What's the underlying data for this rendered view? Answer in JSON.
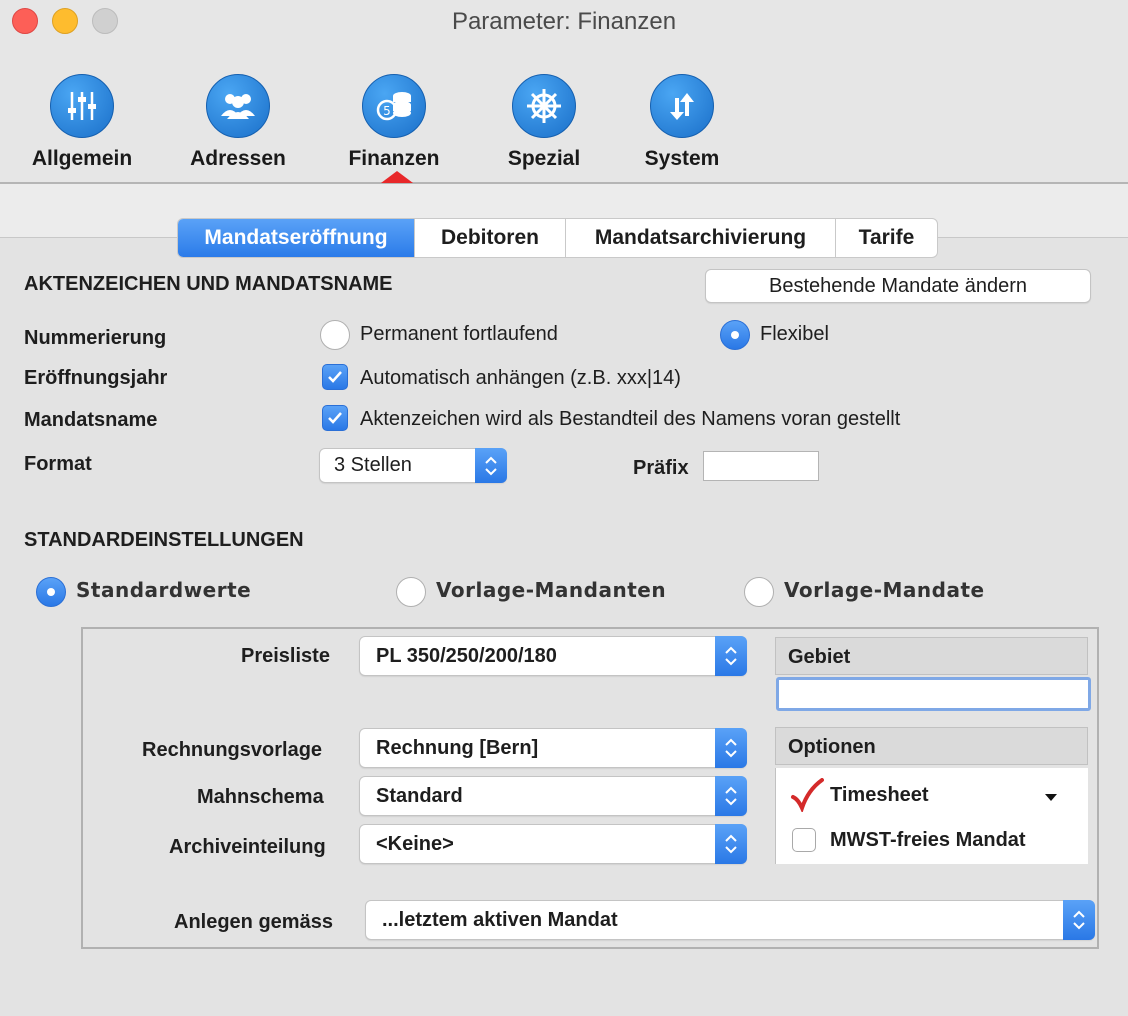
{
  "window": {
    "title": "Parameter: Finanzen"
  },
  "toolbar": {
    "items": [
      {
        "label": "Allgemein",
        "icon": "sliders-icon"
      },
      {
        "label": "Adressen",
        "icon": "people-icon"
      },
      {
        "label": "Finanzen",
        "icon": "coins-icon",
        "selected": true
      },
      {
        "label": "Spezial",
        "icon": "ship-wheel-icon"
      },
      {
        "label": "System",
        "icon": "arrows-icon"
      }
    ]
  },
  "tabs": [
    {
      "label": "Mandatseröffnung",
      "active": true
    },
    {
      "label": "Debitoren"
    },
    {
      "label": "Mandatsarchivierung"
    },
    {
      "label": "Tarife"
    }
  ],
  "aktenzeichen": {
    "heading": "AKTENZEICHEN UND MANDATSNAME",
    "change_button": "Bestehende Mandate ändern",
    "nummerierung": {
      "label": "Nummerierung",
      "option_permanent": "Permanent fortlaufend",
      "option_flexibel": "Flexibel",
      "selected": "Flexibel"
    },
    "eroeffnungsjahr": {
      "label": "Eröffnungsjahr",
      "checkbox": "Automatisch anhängen (z.B. xxx|14)",
      "checked": true
    },
    "mandatsname": {
      "label": "Mandatsname",
      "checkbox": "Aktenzeichen wird als Bestandteil des Namens voran gestellt",
      "checked": true
    },
    "format": {
      "label": "Format",
      "value": "3 Stellen",
      "praefix_label": "Präfix",
      "praefix_value": ""
    }
  },
  "standard": {
    "heading": "STANDARDEINSTELLUNGEN",
    "options": [
      "Standardwerte",
      "Vorlage-Mandanten",
      "Vorlage-Mandate"
    ],
    "selected": "Standardwerte",
    "preisliste": {
      "label": "Preisliste",
      "value": "PL 350/250/200/180"
    },
    "rechnungsvorlage": {
      "label": "Rechnungsvorlage",
      "value": "Rechnung [Bern]"
    },
    "mahnschema": {
      "label": "Mahnschema",
      "value": "Standard"
    },
    "archiveinteilung": {
      "label": "Archiveinteilung",
      "value": "<Keine>"
    },
    "anlegen": {
      "label": "Anlegen gemäss",
      "value": "...letztem aktiven Mandat"
    },
    "gebiet": {
      "header": "Gebiet",
      "value": ""
    },
    "optionen": {
      "header": "Optionen",
      "items": [
        {
          "label": "Timesheet",
          "checked": true
        },
        {
          "label": "MWST-freies Mandat",
          "checked": false
        }
      ]
    }
  },
  "colors": {
    "accent": "#2b7be9",
    "selection_marker": "#e8282a",
    "timesheet_check": "#d42a2a"
  }
}
